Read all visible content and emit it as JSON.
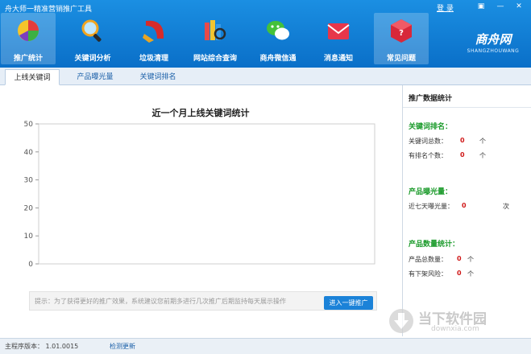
{
  "app": {
    "title": "舟大师一精准营销推广工具",
    "login": "登 录"
  },
  "window_controls": [
    "▣",
    "—",
    "✕"
  ],
  "toolbar": [
    {
      "label": "推广统计",
      "icon": "pie-chart-icon",
      "active": true
    },
    {
      "label": "关键词分析",
      "icon": "magnifier-icon",
      "active": false
    },
    {
      "label": "垃圾清理",
      "icon": "broom-icon",
      "active": false
    },
    {
      "label": "网站综合查询",
      "icon": "books-search-icon",
      "active": false
    },
    {
      "label": "商舟微信通",
      "icon": "wechat-icon",
      "active": false
    },
    {
      "label": "消息通知",
      "icon": "envelope-icon",
      "active": false
    },
    {
      "label": "常见问题",
      "icon": "question-cube-icon",
      "active": true
    }
  ],
  "brand": {
    "logo": "商舟网",
    "sub": "SHANGZHOUWANG"
  },
  "tabs": [
    {
      "label": "上线关键词",
      "active": true
    },
    {
      "label": "产品曝光量",
      "active": false
    },
    {
      "label": "关键词排名",
      "active": false
    }
  ],
  "chart_data": {
    "type": "line",
    "title": "近一个月上线关键词统计",
    "ylim": [
      0,
      50
    ],
    "yticks": [
      "50",
      "40",
      "30",
      "20",
      "10",
      "0"
    ],
    "series": []
  },
  "tip": {
    "text": "提示：为了获得更好的推广效果，系统建议您前期多进行几次推广后期监持每天展示操作",
    "button": "进入一键推广"
  },
  "side": {
    "title": "推广数据统计",
    "keyword_rank": {
      "heading": "关键词排名：",
      "rows": [
        {
          "label": "关键词总数：",
          "value": "0",
          "unit": "个"
        },
        {
          "label": "有排名个数：",
          "value": "0",
          "unit": "个"
        }
      ]
    },
    "exposure": {
      "heading": "产品曝光量：",
      "rows": [
        {
          "label": "近七天曝光量：",
          "value": "0",
          "unit": "次"
        }
      ]
    },
    "product": {
      "heading": "产品数量统计：",
      "rows": [
        {
          "label": "产品总数量：",
          "value": "0",
          "unit": "个"
        },
        {
          "label": "有下架风险：",
          "value": "0",
          "unit": "个"
        }
      ]
    }
  },
  "status": {
    "version": "主程序版本： 1.01.0015",
    "check": "检测更新"
  },
  "watermark": {
    "text": "当下软件园",
    "url": "downxia.com"
  },
  "colors": {
    "brand_blue": "#0a6fc8",
    "value_red": "#d01919",
    "section_green": "#1a9a2a"
  }
}
